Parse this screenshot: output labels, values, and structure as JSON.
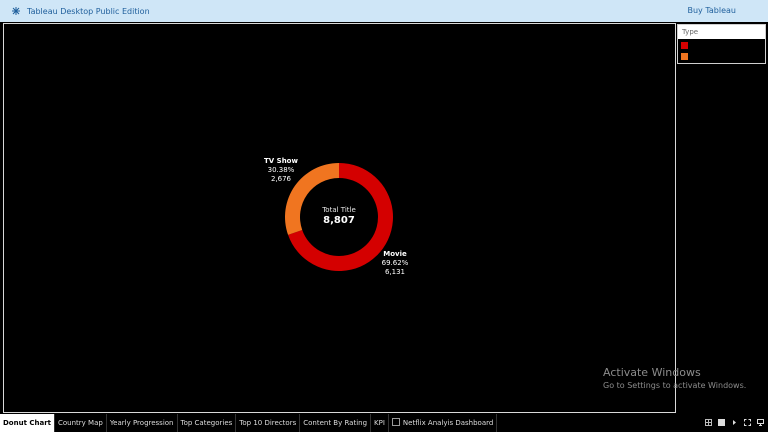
{
  "app": {
    "title": "Tableau Desktop Public Edition",
    "buy_label": "Buy Tableau"
  },
  "legend": {
    "header": "Type",
    "items": [
      {
        "color": "#d40000",
        "label": ""
      },
      {
        "color": "#f07520",
        "label": ""
      }
    ]
  },
  "chart_data": {
    "type": "pie",
    "title": "",
    "center_label": "Total Title",
    "center_value": "8,807",
    "slices": [
      {
        "name": "Movie",
        "percent_label": "69.62%",
        "count_label": "6,131",
        "value": 6131,
        "color": "#d40000"
      },
      {
        "name": "TV Show",
        "percent_label": "30.38%",
        "count_label": "2,676",
        "value": 2676,
        "color": "#f07520"
      }
    ]
  },
  "watermark": {
    "line1": "Activate Windows",
    "line2": "Go to Settings to activate Windows."
  },
  "tabs": [
    {
      "label": "Donut Chart",
      "active": true
    },
    {
      "label": "Country Map"
    },
    {
      "label": "Yearly Progression"
    },
    {
      "label": "Top Categories"
    },
    {
      "label": "Top 10 Directors"
    },
    {
      "label": "Content By Rating"
    },
    {
      "label": "KPI"
    },
    {
      "label": "Netflix Analyis Dashboard",
      "icon": "dashboard-icon"
    }
  ],
  "controls": [
    "grid-view-icon",
    "filmstrip-view-icon",
    "play-icon",
    "fullscreen-icon",
    "present-icon"
  ]
}
